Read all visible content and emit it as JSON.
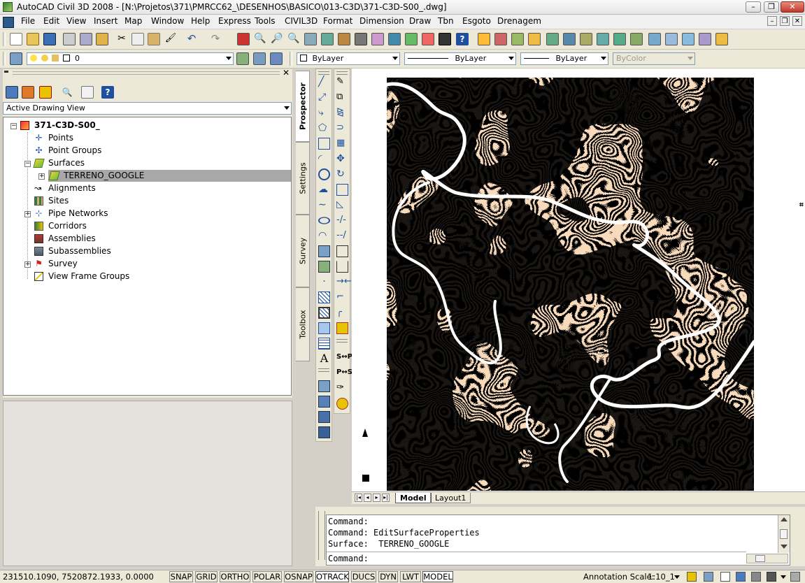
{
  "window": {
    "title": "AutoCAD Civil 3D 2008 - [N:\\Projetos\\371\\PMRCC62_\\DESENHOS\\BASICO\\013-C3D\\371-C3D-S00_.dwg]",
    "minimize": "–",
    "restore": "❐",
    "close": "✕"
  },
  "menu": {
    "items": [
      "File",
      "Edit",
      "View",
      "Insert",
      "Map",
      "Window",
      "Help",
      "Express",
      "Tools",
      "CIVIL3D",
      "Format",
      "Dimension",
      "Draw",
      "Tbn",
      "Esgoto",
      "Drenagem"
    ],
    "mdi_minimize": "–",
    "mdi_restore": "❐",
    "mdi_close": "✕"
  },
  "layer_toolbar": {
    "current_layer": "0"
  },
  "properties_toolbar": {
    "color": "ByLayer",
    "linetype": "ByLayer",
    "lineweight": "ByLayer",
    "plotstyle": "ByColor"
  },
  "prospector": {
    "view_selector": "Active Drawing View",
    "drawing": "371-C3D-S00_",
    "items": [
      {
        "label": "Points",
        "icon": "points-icon"
      },
      {
        "label": "Point Groups",
        "icon": "point-groups-icon"
      },
      {
        "label": "Surfaces",
        "icon": "surfaces-icon"
      },
      {
        "label": "TERRENO_GOOGLE",
        "icon": "surface-icon"
      },
      {
        "label": "Alignments",
        "icon": "alignments-icon"
      },
      {
        "label": "Sites",
        "icon": "sites-icon"
      },
      {
        "label": "Pipe Networks",
        "icon": "pipe-networks-icon"
      },
      {
        "label": "Corridors",
        "icon": "corridors-icon"
      },
      {
        "label": "Assemblies",
        "icon": "assemblies-icon"
      },
      {
        "label": "Subassemblies",
        "icon": "subassemblies-icon"
      },
      {
        "label": "Survey",
        "icon": "survey-icon"
      },
      {
        "label": "View Frame Groups",
        "icon": "view-frame-groups-icon"
      }
    ]
  },
  "side_tabs": [
    "Prospector",
    "Settings",
    "Survey",
    "Toolbox"
  ],
  "layout_tabs": [
    "Model",
    "Layout1"
  ],
  "command": {
    "lines": [
      "Command:",
      "Command: EditSurfaceProperties",
      "Surface:  TERRENO_GOOGLE"
    ],
    "prompt": "Command:"
  },
  "status": {
    "coordinates": "231510.1090, 7520872.1933, 0.0000",
    "toggles": [
      {
        "label": "SNAP",
        "on": false
      },
      {
        "label": "GRID",
        "on": false
      },
      {
        "label": "ORTHO",
        "on": false
      },
      {
        "label": "POLAR",
        "on": false
      },
      {
        "label": "OSNAP",
        "on": false
      },
      {
        "label": "OTRACK",
        "on": true
      },
      {
        "label": "DUCS",
        "on": false
      },
      {
        "label": "DYN",
        "on": false
      },
      {
        "label": "LWT",
        "on": false
      },
      {
        "label": "MODEL",
        "on": true
      }
    ],
    "annotation_scale_label": "Annotation Scale:",
    "annotation_scale_value": "1:10_1"
  },
  "colors": {
    "contour": "#f2b27c",
    "background": "#000000",
    "river": "#ffffff"
  }
}
